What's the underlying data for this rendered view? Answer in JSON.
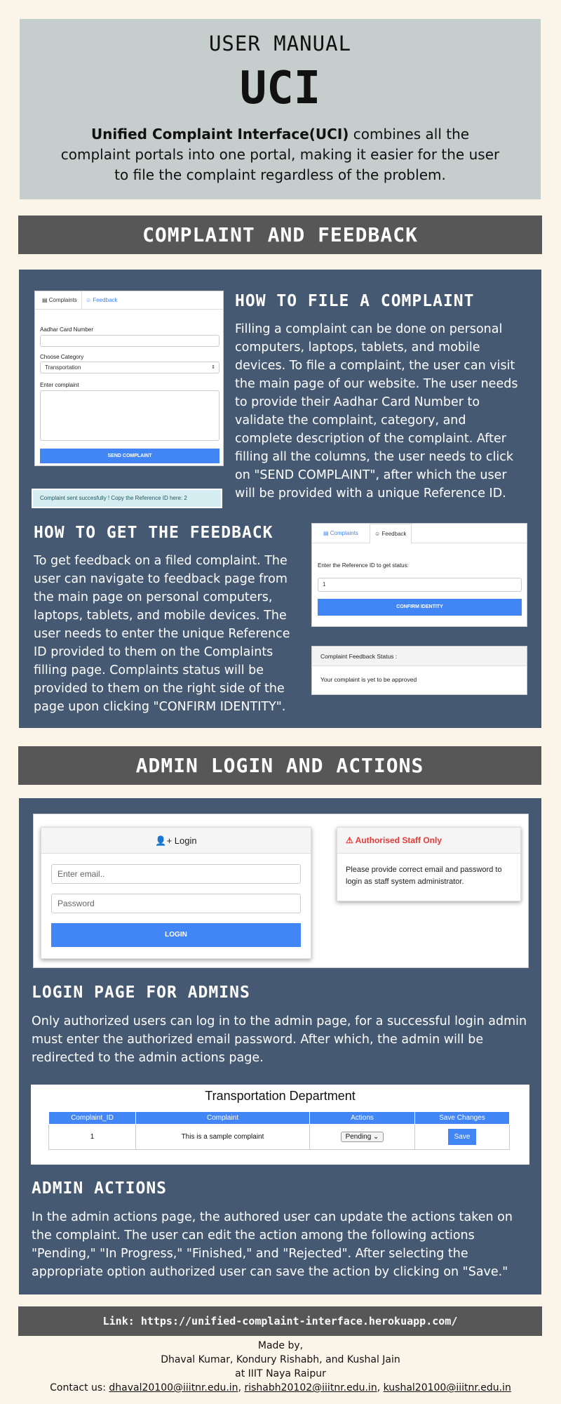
{
  "header": {
    "subtitle": "USER MANUAL",
    "title": "UCI",
    "description_bold": "Unified Complaint Interface(UCI)",
    "description_rest": " combines all the complaint portals into one portal, making it easier for the user to file the complaint regardless of the problem."
  },
  "section1": {
    "band": "COMPLAINT AND FEEDBACK",
    "file": {
      "heading": "HOW TO FILE A COMPLAINT",
      "text": "Filling a complaint can be done on personal computers, laptops, tablets, and mobile devices. To file a complaint, the user can visit the main page of our website. The user needs to provide their Aadhar Card Number to validate the complaint, category, and complete description of the complaint. After filling all the columns, the user needs to click on \"SEND COMPLAINT\", after which the user will be provided with a unique Reference ID."
    },
    "complaint_form": {
      "tab_complaints": "Complaints",
      "tab_feedback": "Feedback",
      "aadhar_label": "Aadhar Card Number",
      "category_label": "Choose Category",
      "category_value": "Transportation",
      "complaint_label": "Enter complaint",
      "send_button": "SEND COMPLAINT",
      "success_message": "Complaint sent succesfully ! Copy the Reference ID here: 2"
    },
    "feedback": {
      "heading": "HOW TO GET THE FEEDBACK",
      "text": "To get feedback on a filed complaint. The user can navigate to feedback page from the main page on personal computers, laptops, tablets, and mobile devices. The user needs to enter the unique Reference ID provided to them on the Complaints filling page. Complaints status will be provided to them on the right side of the page upon clicking \"CONFIRM IDENTITY\"."
    },
    "feedback_form": {
      "tab_complaints": "Complaints",
      "tab_feedback": "Feedback",
      "ref_label": "Enter the Reference ID to get status:",
      "ref_value": "1",
      "confirm_button": "CONFIRM IDENTITY",
      "status_title": "Complaint Feedback Status :",
      "status_text": "Your complaint is yet to be approved"
    }
  },
  "section2": {
    "band": "ADMIN LOGIN AND ACTIONS",
    "login": {
      "title": "Login",
      "email_placeholder": "Enter email..",
      "password_placeholder": "Password",
      "button": "LOGIN",
      "staff_title": "Authorised Staff Only",
      "staff_text": "Please provide correct email and password to login as staff system administrator."
    },
    "login_section": {
      "heading": "LOGIN PAGE FOR ADMINS",
      "text": "Only authorized users can log in to the admin page, for a successful login admin must enter the authorized email password. After which, the admin will be redirected to the admin actions page."
    },
    "table": {
      "title": "Transportation Department",
      "columns": [
        "Complaint_ID",
        "Complaint",
        "Actions",
        "Save Changes"
      ],
      "row": {
        "id": "1",
        "complaint": "This is a sample complaint",
        "action": "Pending",
        "save": "Save"
      }
    },
    "actions_section": {
      "heading": "ADMIN ACTIONS",
      "text": "In the admin actions page, the authored user can update the actions taken on the complaint. The user can edit the action among the following actions \"Pending,\" \"In Progress,\" \"Finished,\" and \"Rejected\". After selecting the appropriate option authorized user can save the action by clicking on \"Save.\""
    }
  },
  "footer": {
    "link_label": "Link: ",
    "link_url": "https://unified-complaint-interface.herokuapp.com/",
    "made_by": "Made by,",
    "authors": "Dhaval Kumar, Kondury Rishabh, and Kushal Jain",
    "institute": "at IIIT Naya Raipur",
    "contact_label": "Contact us: ",
    "email1": "dhaval20100@iiitnr.edu.in",
    "email2": "rishabh20102@iiitnr.edu.in",
    "email3": "kushal20100@iiitnr.edu.in"
  }
}
